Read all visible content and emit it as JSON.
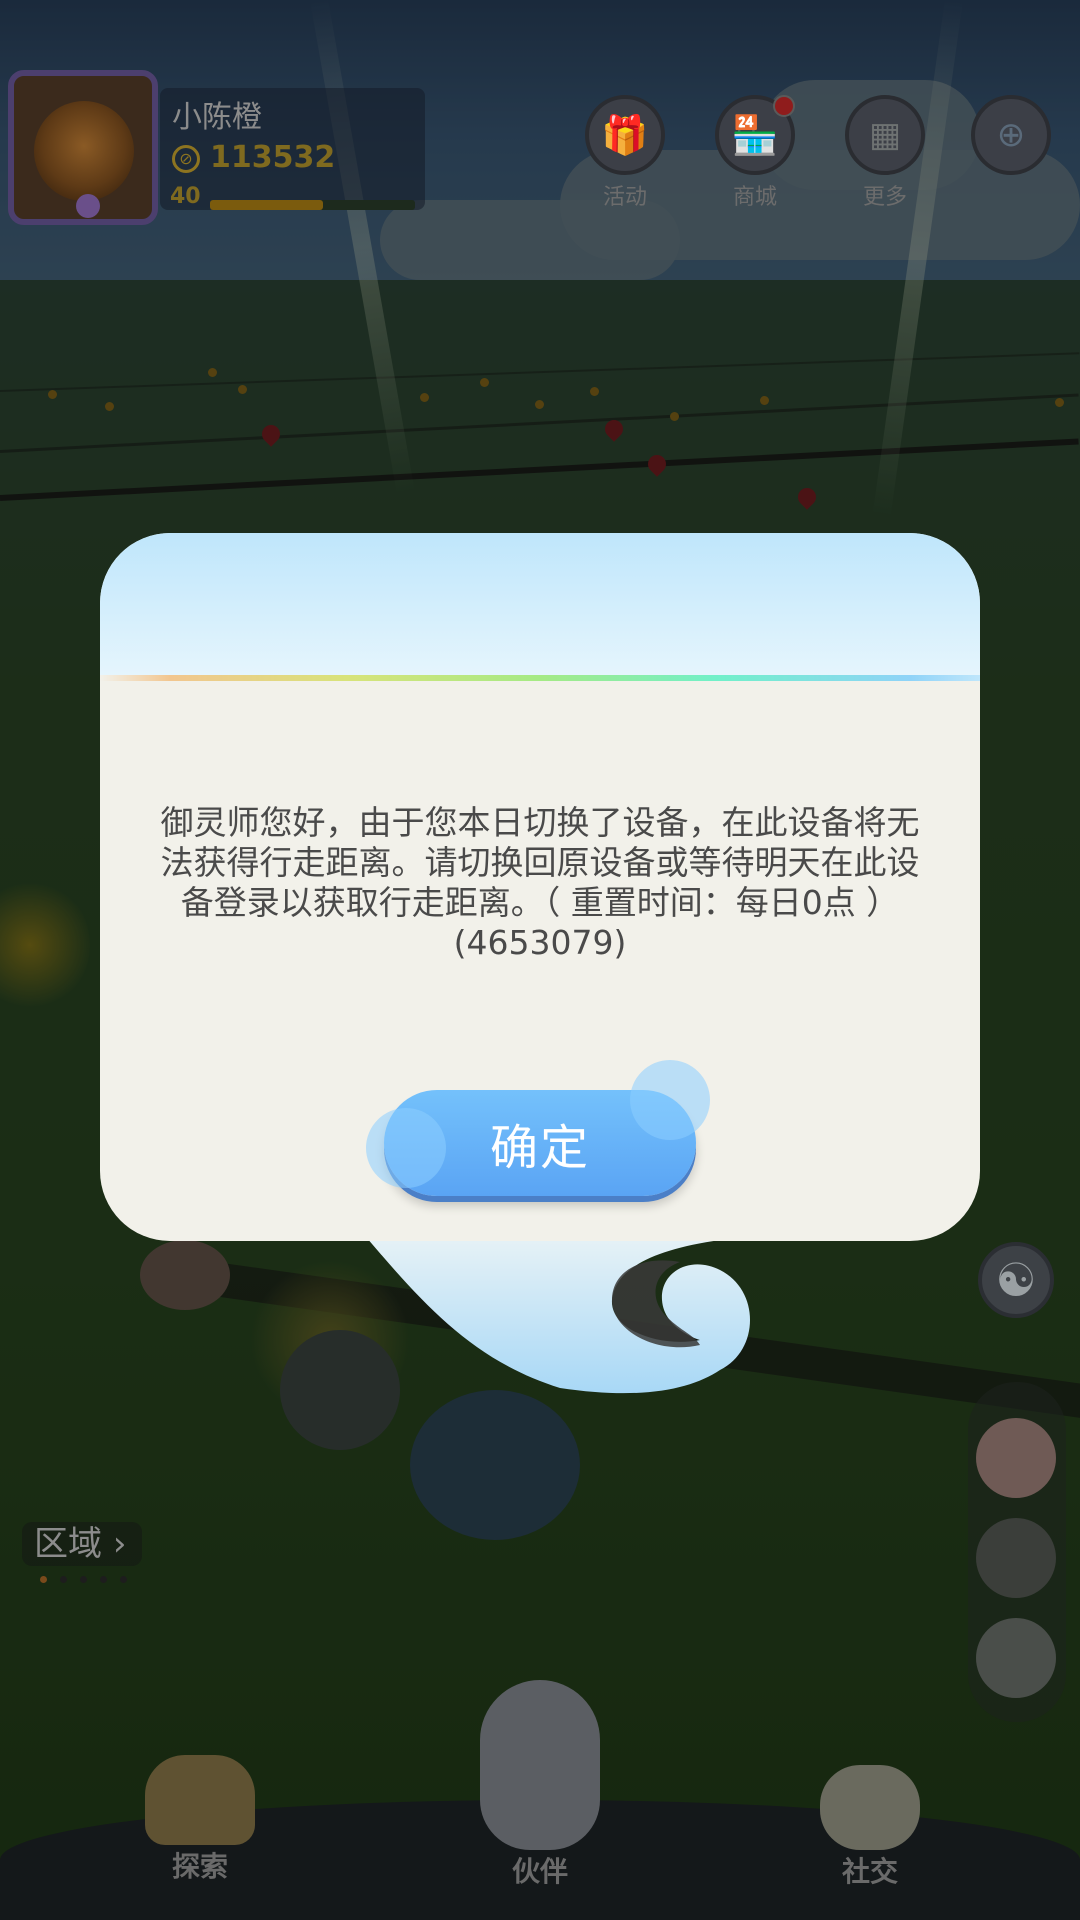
{
  "header": {
    "player_name": "小陈橙",
    "coins": "113532",
    "level": "40",
    "xp_fraction": 0.55,
    "coin_icon": "compass-coin-icon"
  },
  "top_buttons": [
    {
      "label": "活动",
      "icon": "gift-icon"
    },
    {
      "label": "商城",
      "icon": "shop-icon",
      "notification": true
    },
    {
      "label": "更多",
      "icon": "grid-icon"
    }
  ],
  "compass_icon": "compass-icon",
  "region": {
    "label": "区域",
    "arrow": "›"
  },
  "bottom_nav": [
    {
      "label": "探索",
      "icon": "map-pin-icon"
    },
    {
      "label": "伙伴",
      "icon": "spirit-icon"
    },
    {
      "label": "社交",
      "icon": "social-icon"
    }
  ],
  "dialog": {
    "message": "御灵师您好，由于您本日切换了设备，在此设备将无法获得行走距离。请切换回原设备或等待明天在此设备登录以获取行走距离。（ 重置时间：每日0点 ）(4653079)",
    "confirm_label": "确定"
  },
  "colors": {
    "dialog_bg": "#f2f1ea",
    "dialog_header": "#bfe6fb",
    "button_blue": "#5aa4f4",
    "message_text": "#4a4a4a"
  }
}
